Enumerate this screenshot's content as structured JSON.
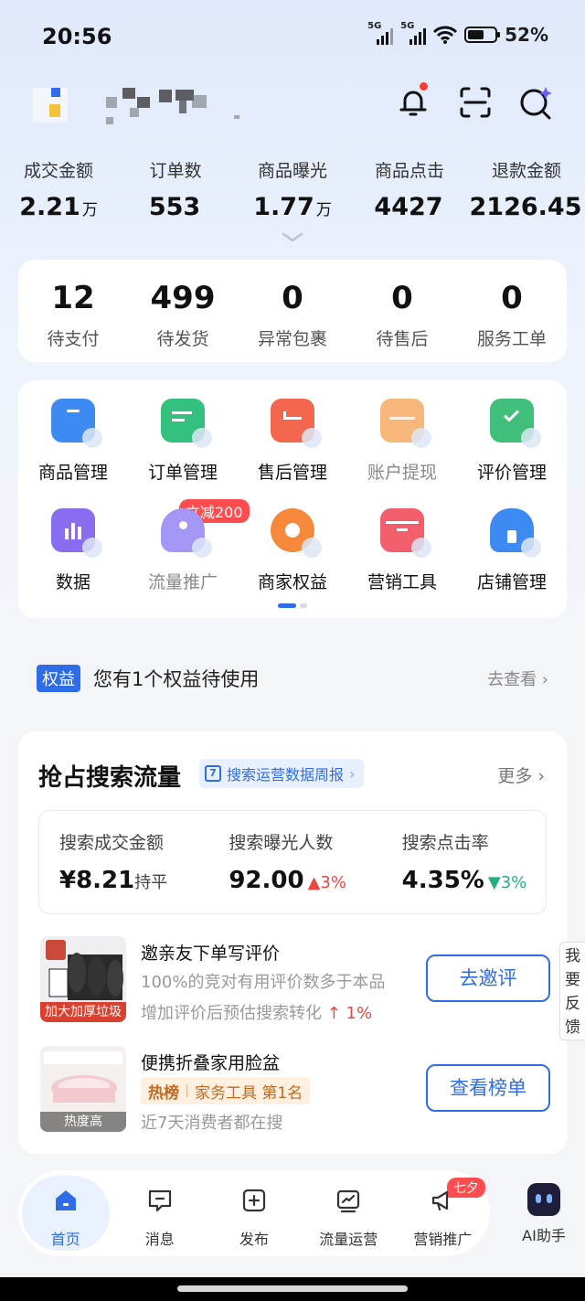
{
  "status_bar": {
    "time": "20:56",
    "net1": "5G",
    "net2": "5G",
    "battery": "52%"
  },
  "top_stats": [
    {
      "label": "成交金额",
      "value": "2.21",
      "unit": "万"
    },
    {
      "label": "订单数",
      "value": "553",
      "unit": ""
    },
    {
      "label": "商品曝光",
      "value": "1.77",
      "unit": "万"
    },
    {
      "label": "商品点击",
      "value": "4427",
      "unit": ""
    },
    {
      "label": "退款金额",
      "value": "2126.45",
      "unit": ""
    }
  ],
  "orders": [
    {
      "value": "12",
      "label": "待支付"
    },
    {
      "value": "499",
      "label": "待发货"
    },
    {
      "value": "0",
      "label": "异常包裹"
    },
    {
      "value": "0",
      "label": "待售后"
    },
    {
      "value": "0",
      "label": "服务工单"
    }
  ],
  "tools": [
    {
      "label": "商品管理",
      "color": "#3d8bf2"
    },
    {
      "label": "订单管理",
      "color": "#34c07e"
    },
    {
      "label": "售后管理",
      "color": "#f3674e"
    },
    {
      "label": "账户提现",
      "color": "#f7b77a"
    },
    {
      "label": "评价管理",
      "color": "#3fbf7a"
    },
    {
      "label": "数据",
      "color": "#8a6cf0"
    },
    {
      "label": "流量推广",
      "color": "#a496f5",
      "badge": "立减200"
    },
    {
      "label": "商家权益",
      "color": "#f5883b"
    },
    {
      "label": "营销工具",
      "color": "#f25e6b"
    },
    {
      "label": "店铺管理",
      "color": "#3d8bf2"
    }
  ],
  "benefit": {
    "tag": "权益",
    "text": "您有1个权益待使用",
    "link": "去查看"
  },
  "search": {
    "title": "抢占搜索流量",
    "report": "搜索运营数据周报",
    "report_day": "7",
    "more": "更多",
    "metrics": [
      {
        "label": "搜索成交金额",
        "value": "¥8.21",
        "suffix": "持平",
        "trend": ""
      },
      {
        "label": "搜索曝光人数",
        "value": "92.00",
        "suffix": "",
        "trend": "up",
        "trend_value": "3%"
      },
      {
        "label": "搜索点击率",
        "value": "4.35%",
        "suffix": "",
        "trend": "down",
        "trend_value": "3%"
      }
    ],
    "item1": {
      "title": "邀亲友下单写评价",
      "desc": "100%的竞对有用评价数多于本品",
      "desc2": "增加评价后预估搜索转化",
      "lift": "↑ 1%",
      "thumb_caption": "加大加厚垃圾袋",
      "button": "去邀评"
    },
    "item2": {
      "title": "便携折叠家用脸盆",
      "rank_tag": "热榜",
      "rank_cat": "家务工具 第1名",
      "desc": "近7天消费者都在搜",
      "thumb_caption": "热度高",
      "button": "查看榜单"
    }
  },
  "feedback": "我要反馈",
  "nav": [
    {
      "label": "首页",
      "active": true
    },
    {
      "label": "消息"
    },
    {
      "label": "发布"
    },
    {
      "label": "流量运营"
    },
    {
      "label": "营销推广",
      "badge": "七夕"
    }
  ],
  "ai_assistant": "AI助手",
  "colors": {
    "accent": "#2f6de8",
    "danger": "#e8483f",
    "success": "#23b07d"
  }
}
